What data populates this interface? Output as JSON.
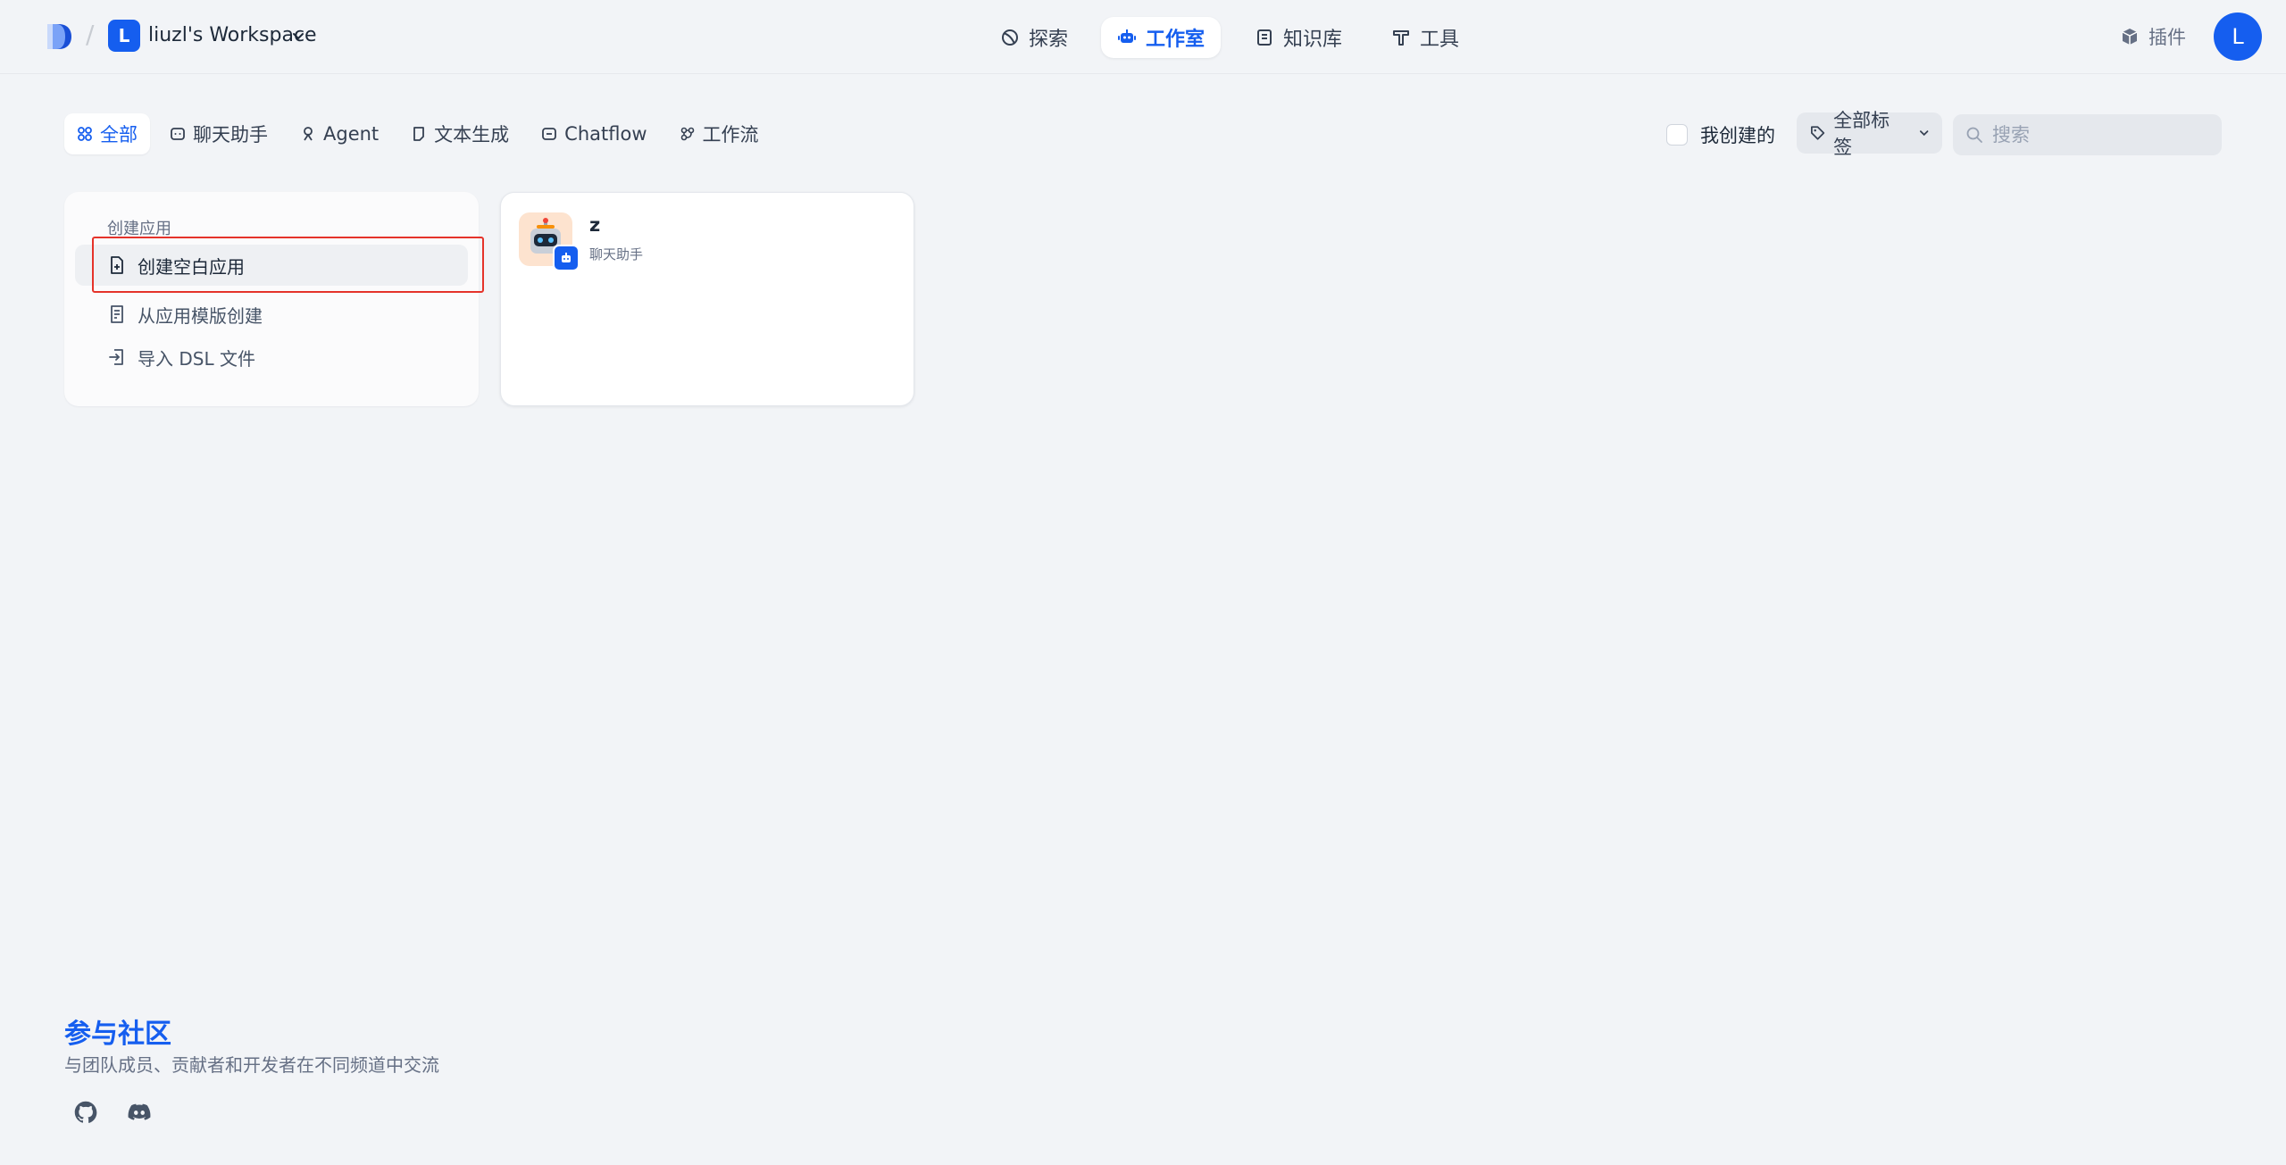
{
  "header": {
    "workspace_initial": "L",
    "workspace_name": "liuzl's Workspace",
    "nav": [
      {
        "label": "探索",
        "icon": "explore-icon",
        "active": false
      },
      {
        "label": "工作室",
        "icon": "robot-icon",
        "active": true
      },
      {
        "label": "知识库",
        "icon": "book-icon",
        "active": false
      },
      {
        "label": "工具",
        "icon": "hammer-icon",
        "active": false
      }
    ],
    "plugin_label": "插件",
    "avatar_initial": "L"
  },
  "filters": {
    "tabs": [
      {
        "label": "全部",
        "icon": "grid-icon",
        "active": true
      },
      {
        "label": "聊天助手",
        "icon": "chat-bubble-icon",
        "active": false
      },
      {
        "label": "Agent",
        "icon": "agent-icon",
        "active": false
      },
      {
        "label": "文本生成",
        "icon": "document-icon",
        "active": false
      },
      {
        "label": "Chatflow",
        "icon": "chatflow-icon",
        "active": false
      },
      {
        "label": "工作流",
        "icon": "workflow-icon",
        "active": false
      }
    ],
    "created_by_me_label": "我创建的",
    "tags_label": "全部标签",
    "search_placeholder": "搜索"
  },
  "create_panel": {
    "title": "创建应用",
    "items": [
      {
        "label": "创建空白应用",
        "icon": "file-plus-icon"
      },
      {
        "label": "从应用模版创建",
        "icon": "template-icon"
      },
      {
        "label": "导入 DSL 文件",
        "icon": "import-icon"
      }
    ]
  },
  "apps": [
    {
      "name": "z",
      "type": "聊天助手",
      "icon": "robot-avatar-icon",
      "badge": "chat-badge-icon"
    }
  ],
  "community": {
    "title": "参与社区",
    "subtitle": "与团队成员、贡献者和开发者在不同频道中交流",
    "links": [
      {
        "icon": "github-icon"
      },
      {
        "icon": "discord-icon"
      }
    ]
  },
  "colors": {
    "accent": "#155eef",
    "background": "#f2f4f7",
    "highlight_box": "#e5332a"
  }
}
